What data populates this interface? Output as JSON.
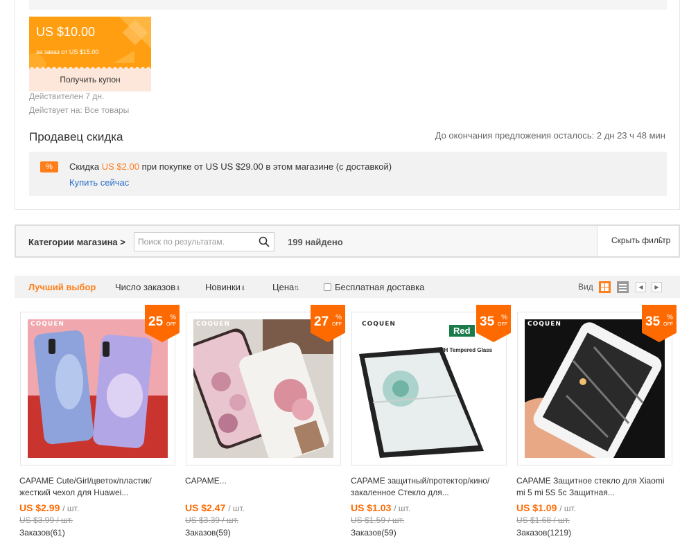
{
  "coupon": {
    "amount": "US $10.00",
    "condition": "за заказ от US $15.00",
    "button_label": "Получить купон",
    "validity": "Действителен 7 дн.",
    "applies_to": "Действует на: Все товары"
  },
  "seller_discount": {
    "title": "Продавец скидка",
    "countdown": "До окончания предложения осталось: 2 дн 23 ч 48 мин",
    "icon_text": "%",
    "text_prefix": "Скидка",
    "discount_value": "US $2.00",
    "text_middle": "при покупке от US",
    "min_value": "US $29.00",
    "text_suffix": "в этом магазине (с доставкой)",
    "buy_now": "Купить сейчас"
  },
  "store_bar": {
    "categories_label": "Категории магазина >",
    "search_placeholder": "Поиск по результатам.",
    "found": "199 найдено",
    "hide_filter": "Скрыть фильтр"
  },
  "sort_bar": {
    "best": "Лучший выбор",
    "orders": "Число заказов",
    "new": "Новинки",
    "price": "Цена",
    "free_shipping": "Бесплатная доставка",
    "view_label": "Вид"
  },
  "colors": {
    "accent": "#ff6a00",
    "coupon": "#ff9e10",
    "link": "#2a6eca"
  },
  "products": [
    {
      "brand": "COQUEN",
      "discount": "25",
      "title": "CAPAME Cute/Girl/цветок/пластик/жесткий чехол для Huawei...",
      "price": "US $2.99",
      "unit": "/ шт.",
      "old_price": "US $3.99 / шт.",
      "orders": "Заказов(61)"
    },
    {
      "brand": "COQUEN",
      "discount": "27",
      "title": "CAPAME...",
      "price": "US $2.47",
      "unit": "/ шт.",
      "old_price": "US $3.39 / шт.",
      "orders": "Заказов(59)"
    },
    {
      "brand": "COQUEN",
      "discount": "35",
      "title": "CAPAME защитный/протектор/кино/закаленное Стекло для...",
      "price": "US $1.03",
      "unit": "/ шт.",
      "old_price": "US $1.59 / шт.",
      "orders": "Заказов(59)"
    },
    {
      "brand": "COQUEN",
      "discount": "35",
      "title": "CAPAME Защитное стекло для Xiaomi mi 5 mi 5S 5c Защитная...",
      "price": "US $1.09",
      "unit": "/ шт.",
      "old_price": "US $1.68 / шт.",
      "orders": "Заказов(1219)"
    }
  ],
  "badge_labels": {
    "percent": "%",
    "off": "OFF"
  },
  "image_texts": {
    "red": "Red",
    "glass": "9H Tempered Glass"
  }
}
